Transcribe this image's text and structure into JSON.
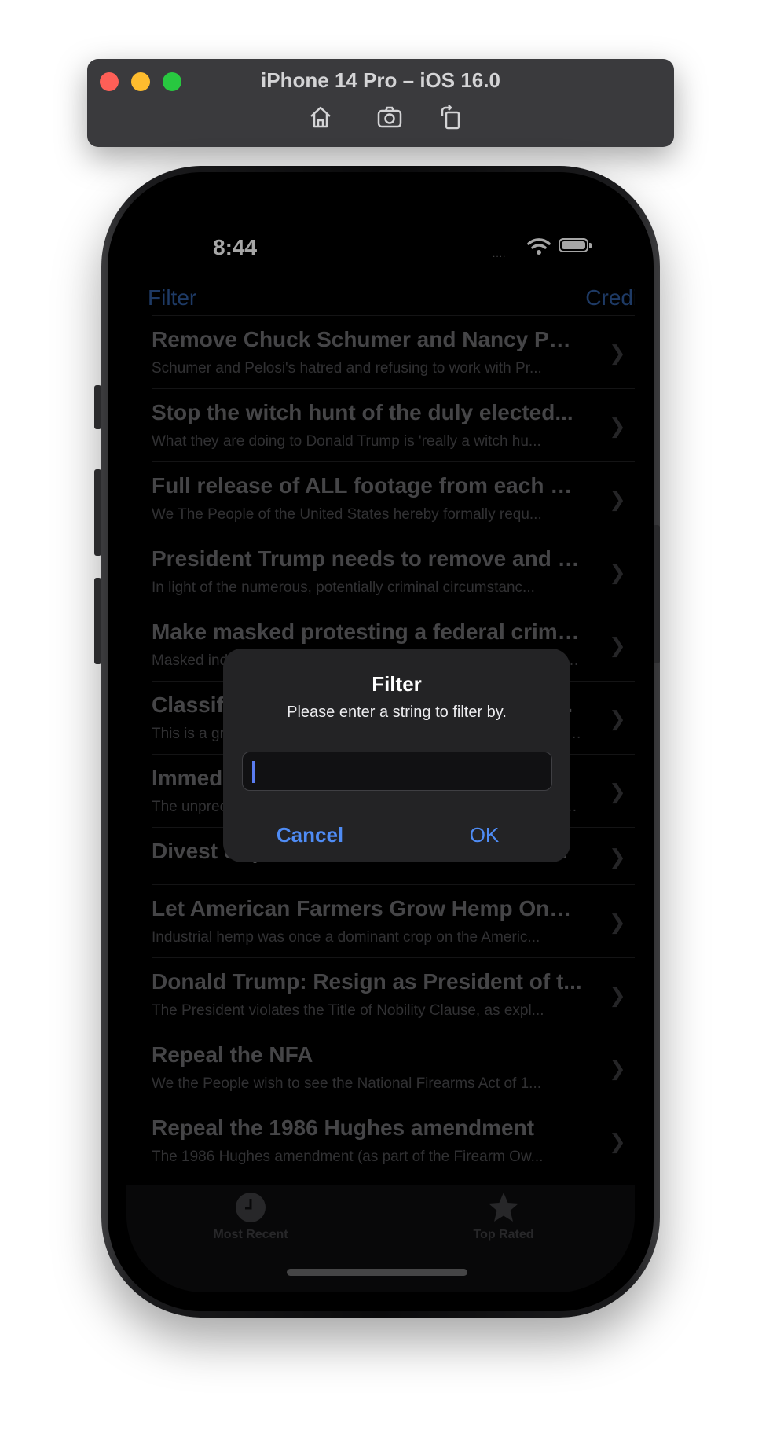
{
  "window": {
    "title": "iPhone 14 Pro – iOS 16.0"
  },
  "toolbar": {
    "icons": [
      "home-icon",
      "screenshot-icon",
      "rotate-icon"
    ]
  },
  "status_bar": {
    "time": "8:44",
    "signal": "...."
  },
  "nav": {
    "left_label": "Filter",
    "right_label": "Credits"
  },
  "list": {
    "rows": [
      {
        "title": "Remove Chuck Schumer and Nancy Pel...",
        "subtitle": "Schumer and Pelosi's hatred and refusing to work with Pr..."
      },
      {
        "title": "Stop the witch hunt of the duly elected...",
        "subtitle": "What they are doing to Donald Trump is 'really a witch hu..."
      },
      {
        "title": "Full release of ALL footage from each vi...",
        "subtitle": "We The People of the United States hereby formally requ..."
      },
      {
        "title": "President Trump needs to remove and r...",
        "subtitle": "In light of the numerous, potentially criminal circumstanc..."
      },
      {
        "title": "Make masked protesting a federal crime...",
        "subtitle": "Masked individuals have been causing violence and destruction peaceful people..."
      },
      {
        "title": "Classify Antifa as a domestic terrorist organization for r...",
        "subtitle": "This is a group that uses violence and intimidation to achieve politica..."
      },
      {
        "title": "Immediately release Jeffrey Epstein files in full...",
        "subtitle": "The unprecedented action of the federal government in this case is extra..."
      },
      {
        "title": "Divest or put in a blind trust all of the Pr...",
        "subtitle": ""
      },
      {
        "title": "Let American Farmers Grow Hemp Once...",
        "subtitle": "Industrial hemp was once a dominant crop on the Americ..."
      },
      {
        "title": "Donald Trump:  Resign as President of t...",
        "subtitle": "The President violates the Title of Nobility Clause, as expl..."
      },
      {
        "title": "Repeal the NFA",
        "subtitle": "We the People wish to see the National Firearms Act of 1..."
      },
      {
        "title": "Repeal the 1986 Hughes amendment",
        "subtitle": "The 1986 Hughes amendment (as part of the Firearm Ow..."
      }
    ]
  },
  "tabs": [
    {
      "label": "Most Recent",
      "icon": "clock-icon"
    },
    {
      "label": "Top Rated",
      "icon": "star-icon"
    }
  ],
  "alert": {
    "title": "Filter",
    "message": "Please enter a string to filter by.",
    "input_value": "",
    "cancel_label": "Cancel",
    "ok_label": "OK"
  },
  "colors": {
    "accent": "#4f8cf5",
    "background": "#000000",
    "alert_bg": "#232325"
  }
}
